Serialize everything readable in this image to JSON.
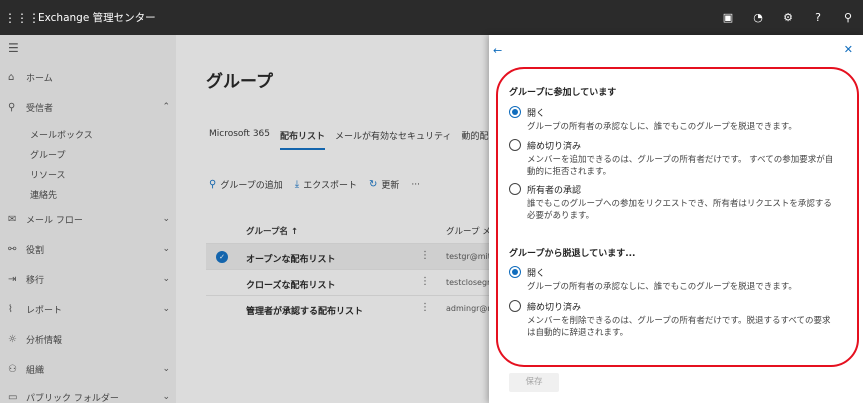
{
  "app": {
    "title": "Exchange 管理センター"
  },
  "nav": {
    "home": "ホーム",
    "recipients": "受信者",
    "mailbox": "メールボックス",
    "groups": "グループ",
    "resources": "リソース",
    "contacts": "連絡先",
    "mailflow": "メール フロー",
    "roles": "役割",
    "migration": "移行",
    "reports": "レポート",
    "insights": "分析情報",
    "organization": "組織",
    "public_folders": "パブリック フォルダー"
  },
  "main": {
    "title": "グループ",
    "tabs": [
      "Microsoft 365",
      "配布リスト",
      "メールが有効なセキュリティ",
      "動的配"
    ],
    "toolbar": {
      "add": "グループの追加",
      "export": "エクスポート",
      "refresh": "更新",
      "more": "···"
    },
    "columns": {
      "name": "グループ名 ↑",
      "email": "グループ メ"
    },
    "rows": [
      {
        "name": "オープンな配布リスト",
        "email": "testgr@mit"
      },
      {
        "name": "クローズな配布リスト",
        "email": "testclosegr"
      },
      {
        "name": "管理者が承認する配布リスト",
        "email": "admingr@r"
      }
    ]
  },
  "panel": {
    "join_title": "グループに参加しています",
    "join_options": [
      {
        "label": "開く",
        "desc": "グループの所有者の承認なしに、誰でもこのグループを脱退できます。",
        "selected": true
      },
      {
        "label": "締め切り済み",
        "desc": "メンバーを追加できるのは、グループの所有者だけです。 すべての参加要求が自動的に拒否されます。",
        "selected": false
      },
      {
        "label": "所有者の承認",
        "desc": "誰でもこのグループへの参加をリクエストでき、所有者はリクエストを承認する必要があります。",
        "selected": false
      }
    ],
    "leave_title": "グループから脱退しています...",
    "leave_options": [
      {
        "label": "開く",
        "desc": "グループの所有者の承認なしに、誰でもこのグループを脱退できます。",
        "selected": true
      },
      {
        "label": "締め切り済み",
        "desc": "メンバーを削除できるのは、グループの所有者だけです。脱退するすべての要求は自動的に辞退されます。",
        "selected": false
      }
    ],
    "save": "保存"
  }
}
